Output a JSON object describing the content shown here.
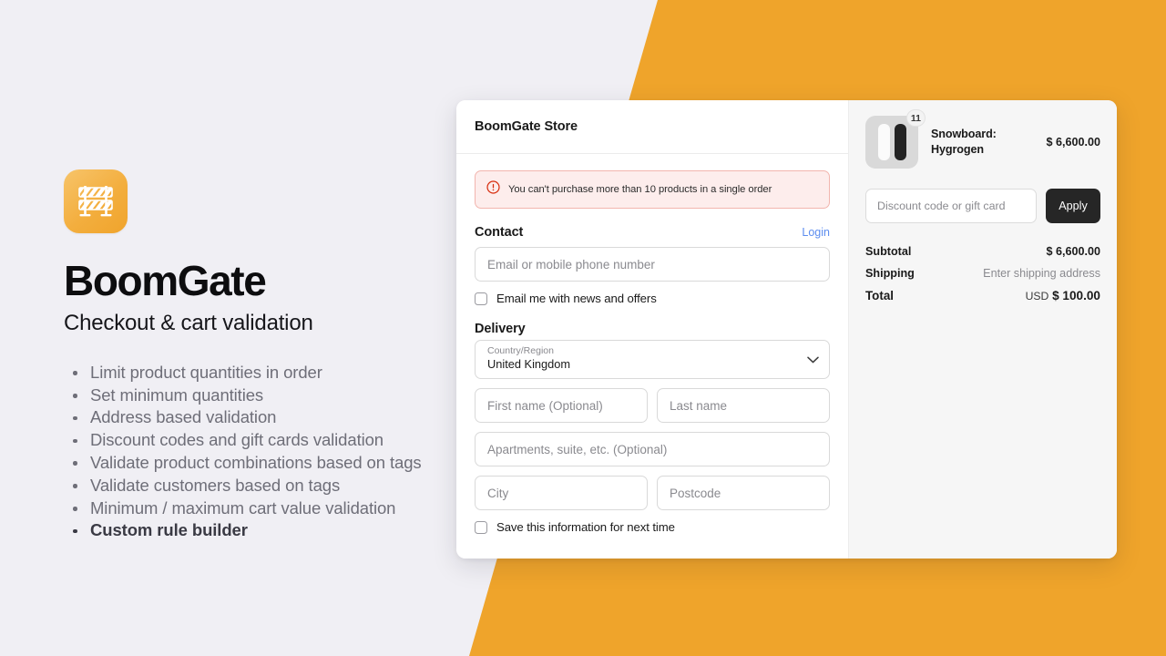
{
  "colors": {
    "page_background": "#F0EFF4",
    "accent_orange": "#EFA42B",
    "link_blue": "#5C8DEF",
    "error_red": "#D72C0D",
    "error_bg": "#FDEDEC",
    "button_dark": "#262626"
  },
  "branding": {
    "logo_icon": "construction-barrier-icon",
    "title": "BoomGate",
    "subtitle": "Checkout & cart validation",
    "features": [
      {
        "text": "Limit product quantities in order",
        "emphasis": false
      },
      {
        "text": "Set minimum quantities",
        "emphasis": false
      },
      {
        "text": "Address based validation",
        "emphasis": false
      },
      {
        "text": "Discount codes and gift cards validation",
        "emphasis": false
      },
      {
        "text": "Validate product combinations based on tags",
        "emphasis": false
      },
      {
        "text": "Validate customers based on tags",
        "emphasis": false
      },
      {
        "text": "Minimum / maximum cart value validation",
        "emphasis": false
      },
      {
        "text": "Custom rule builder",
        "emphasis": true
      }
    ]
  },
  "checkout": {
    "store_name": "BoomGate Store",
    "error": {
      "icon": "error-circle-icon",
      "message": "You can't purchase more than 10 products in a single order"
    },
    "contact": {
      "title": "Contact",
      "login_label": "Login",
      "email_placeholder": "Email or mobile phone number",
      "email_value": "",
      "newsletter_label": "Email me with news and offers",
      "newsletter_checked": false
    },
    "delivery": {
      "title": "Delivery",
      "country": {
        "label": "Country/Region",
        "value": "United Kingdom",
        "chevron": "chevron-down-icon"
      },
      "first_name_placeholder": "First name (Optional)",
      "first_name_value": "",
      "last_name_placeholder": "Last name",
      "last_name_value": "",
      "address2_placeholder": "Apartments, suite, etc. (Optional)",
      "address2_value": "",
      "city_placeholder": "City",
      "city_value": "",
      "postcode_placeholder": "Postcode",
      "postcode_value": "",
      "save_info_label": "Save this information for next time",
      "save_info_checked": false
    }
  },
  "summary": {
    "line_item": {
      "title": "Snowboard: Hygrogen",
      "quantity": "11",
      "price": "$ 6,600.00",
      "thumbnail": "snowboard-pair-image"
    },
    "discount": {
      "placeholder": "Discount code or gift card",
      "value": "",
      "apply_label": "Apply"
    },
    "totals": [
      {
        "label": "Subtotal",
        "value": "$ 6,600.00",
        "muted": false
      },
      {
        "label": "Shipping",
        "value": "Enter shipping address",
        "muted": true
      }
    ],
    "grand_total": {
      "label": "Total",
      "currency": "USD",
      "amount": "$ 100.00"
    }
  }
}
